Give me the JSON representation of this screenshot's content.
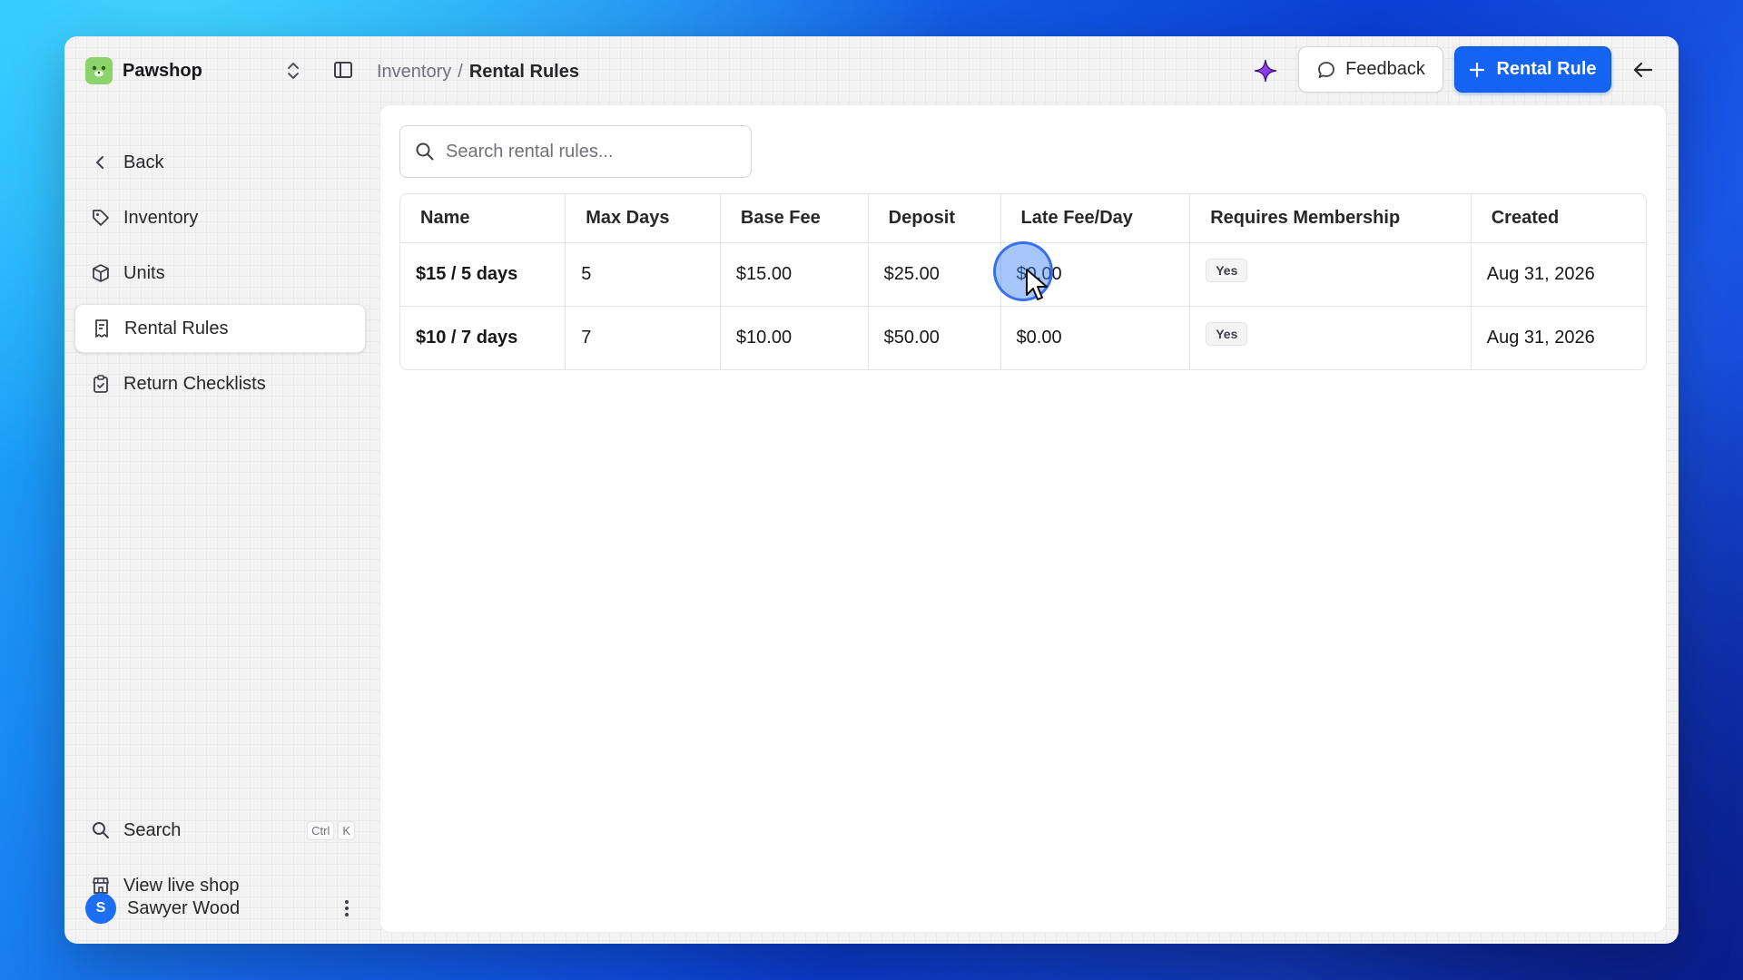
{
  "brand": {
    "name": "Pawshop"
  },
  "nav": {
    "items": [
      {
        "label": "Back",
        "icon": "chevron-left-icon"
      },
      {
        "label": "Inventory",
        "icon": "tag-icon"
      },
      {
        "label": "Units",
        "icon": "package-icon"
      },
      {
        "label": "Rental Rules",
        "icon": "receipt-icon",
        "active": true
      },
      {
        "label": "Return Checklists",
        "icon": "clipboard-check-icon"
      }
    ],
    "bottom": {
      "search_label": "Search",
      "search_shortcut": [
        "Ctrl",
        "K"
      ],
      "live_shop_label": "View live shop"
    }
  },
  "user": {
    "initial": "S",
    "name": "Sawyer Wood"
  },
  "header": {
    "breadcrumb_parent": "Inventory",
    "breadcrumb_sep": "/",
    "breadcrumb_current": "Rental Rules",
    "feedback_label": "Feedback",
    "primary_label": "Rental Rule"
  },
  "search": {
    "placeholder": "Search rental rules..."
  },
  "table": {
    "columns": [
      "Name",
      "Max Days",
      "Base Fee",
      "Deposit",
      "Late Fee/Day",
      "Requires Membership",
      "Created"
    ],
    "rows": [
      {
        "name": "$15 / 5 days",
        "max_days": "5",
        "base_fee": "$15.00",
        "deposit": "$25.00",
        "late_fee": "$0.00",
        "membership": "Yes",
        "created": "Aug 31, 2026"
      },
      {
        "name": "$10 / 7 days",
        "max_days": "7",
        "base_fee": "$10.00",
        "deposit": "$50.00",
        "late_fee": "$0.00",
        "membership": "Yes",
        "created": "Aug 31, 2026"
      }
    ]
  },
  "colors": {
    "accent": "#1463f3",
    "brand_logo": "#8bd36a",
    "sparkle": "#7c3aed"
  }
}
